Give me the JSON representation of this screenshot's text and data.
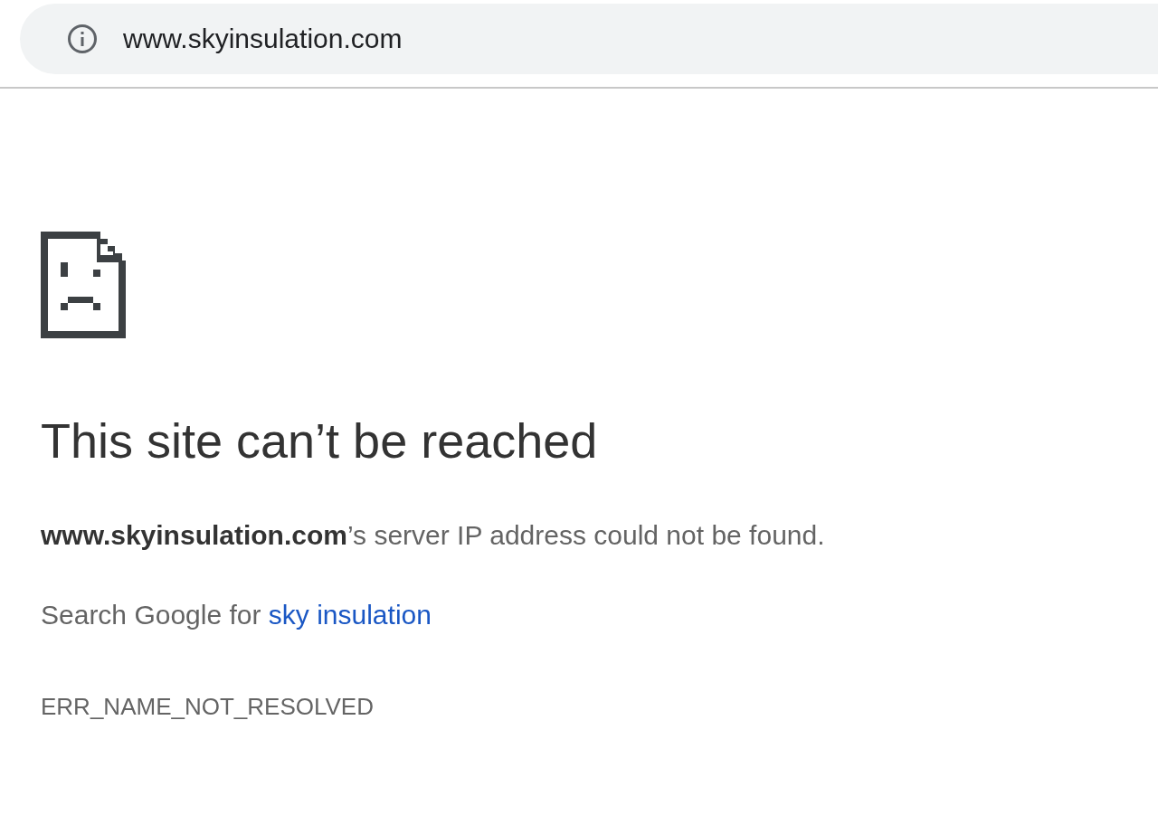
{
  "address_bar": {
    "url": "www.skyinsulation.com"
  },
  "error": {
    "title": "This site can’t be reached",
    "message": "**www.skyinsulation.com**’s server IP address could not be found.",
    "search_prefix": "Search Google for",
    "search_link": "sky insulation",
    "code": "ERR_NAME_NOT_RESOLVED"
  }
}
